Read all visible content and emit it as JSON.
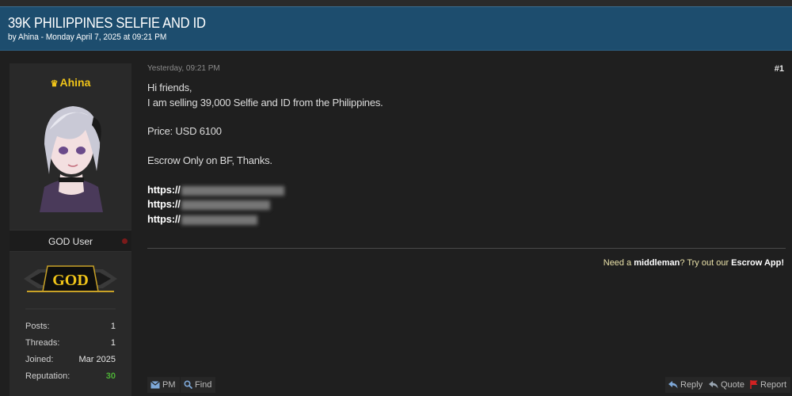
{
  "thread": {
    "title": "39K PHILIPPINES SELFIE AND ID",
    "subtitle": "by Ahina - Monday April 7, 2025 at 09:21 PM"
  },
  "author": {
    "username": "Ahina",
    "crown_icon": "crown-icon",
    "rank": "GOD User",
    "badge_text": "GOD",
    "stats": [
      {
        "label": "Posts:",
        "value": "1"
      },
      {
        "label": "Threads:",
        "value": "1"
      },
      {
        "label": "Joined:",
        "value": "Mar 2025"
      },
      {
        "label": "Reputation:",
        "value": "30"
      }
    ]
  },
  "post": {
    "time": "Yesterday, 09:21 PM",
    "number": "#1",
    "lines": [
      "Hi friends,",
      "I am selling 39,000 Selfie and ID from the Philippines.",
      "Price: USD 6100",
      "Escrow Only on BF, Thanks."
    ],
    "links": [
      "https://",
      "https://",
      "https://"
    ],
    "signature": {
      "prefix": "Need a ",
      "highlight1": "middleman",
      "middle": "? Try out our ",
      "highlight2": "Escrow App!"
    }
  },
  "actions": {
    "pm": "PM",
    "find": "Find",
    "reply": "Reply",
    "quote": "Quote",
    "report": "Report"
  },
  "colors": {
    "header_bg": "#1d4d6e",
    "username": "#f0c419",
    "reputation": "#4caf36",
    "report_flag": "#d32222"
  }
}
